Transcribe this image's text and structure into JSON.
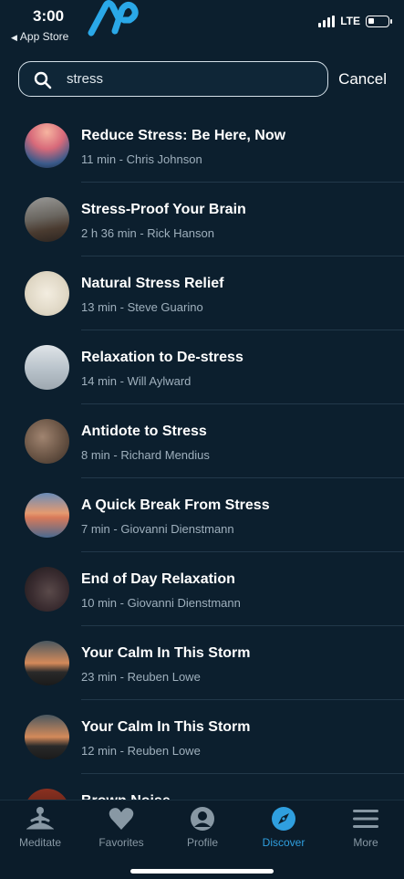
{
  "status_bar": {
    "time": "3:00",
    "back_label": "App Store",
    "network": "LTE",
    "battery_level": 0.3
  },
  "search": {
    "query": "stress",
    "cancel_label": "Cancel"
  },
  "results": [
    {
      "title": "Reduce Stress: Be Here, Now",
      "meta": "11 min - Chris Johnson"
    },
    {
      "title": "Stress-Proof Your Brain",
      "meta": "2 h 36 min - Rick Hanson"
    },
    {
      "title": "Natural Stress Relief",
      "meta": "13 min - Steve Guarino"
    },
    {
      "title": "Relaxation to De-stress",
      "meta": "14 min - Will Aylward"
    },
    {
      "title": "Antidote to Stress",
      "meta": "8 min - Richard Mendius"
    },
    {
      "title": "A Quick Break From Stress",
      "meta": "7 min - Giovanni Dienstmann"
    },
    {
      "title": "End of Day Relaxation",
      "meta": "10 min - Giovanni Dienstmann"
    },
    {
      "title": "Your Calm In This Storm",
      "meta": "23 min - Reuben Lowe"
    },
    {
      "title": "Your Calm In This Storm",
      "meta": "12 min - Reuben Lowe"
    },
    {
      "title": "Brown Noise",
      "meta": ""
    }
  ],
  "tabs": [
    {
      "label": "Meditate",
      "icon": "meditate-icon",
      "active": false
    },
    {
      "label": "Favorites",
      "icon": "heart-icon",
      "active": false
    },
    {
      "label": "Profile",
      "icon": "profile-icon",
      "active": false
    },
    {
      "label": "Discover",
      "icon": "compass-icon",
      "active": true
    },
    {
      "label": "More",
      "icon": "menu-icon",
      "active": false
    }
  ],
  "colors": {
    "background": "#0c1f2e",
    "accent": "#2f9fdf",
    "inactive_tab": "#8898a4",
    "meta_text": "#9fb0bd"
  }
}
